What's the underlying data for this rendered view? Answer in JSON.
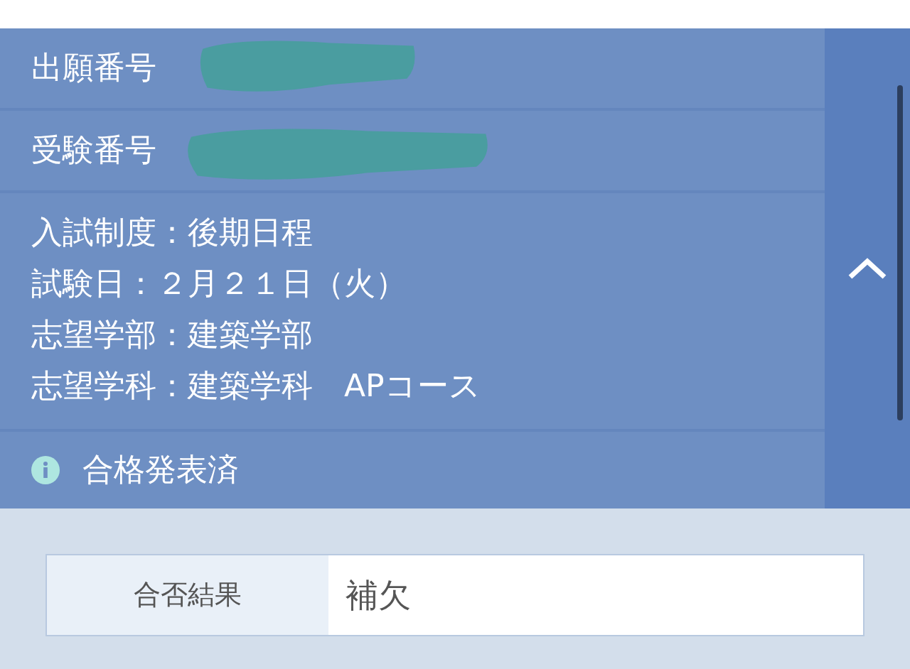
{
  "panel": {
    "expanded": true,
    "numbers": [
      {
        "label": "出願番号",
        "redacted": true
      },
      {
        "label": "受験番号",
        "redacted": true
      }
    ],
    "details": [
      "入試制度：後期日程",
      "試験日：２月２１日（火）",
      "志望学部：建築学部",
      "志望学科：建築学科　APコース"
    ],
    "status": "合格発表済"
  },
  "result": {
    "label": "合否結果",
    "value": "補欠"
  }
}
